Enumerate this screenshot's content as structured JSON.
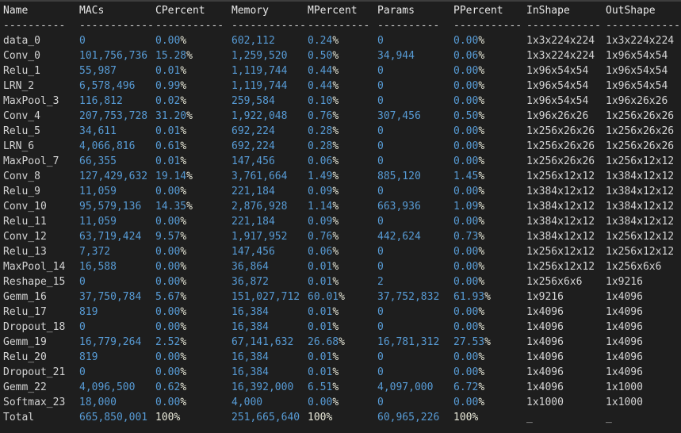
{
  "terminal": {
    "background": "#1e1e1e",
    "top_border": "#3d3d3d",
    "foreground": "#d4d4d4",
    "header_color": "#e8e8e8",
    "number_color": "#579bd5",
    "percent_sign_color": "#e9e9d9"
  },
  "table": {
    "columns": [
      "Name",
      "MACs",
      "CPercent",
      "Memory",
      "MPercent",
      "Params",
      "PPercent",
      "InShape",
      "OutShape"
    ],
    "separators": [
      "----------",
      "------------",
      "-----------",
      "------------",
      "----------",
      "----------",
      "-----------",
      "------------",
      "------------"
    ],
    "rows": [
      [
        "data_0",
        "0",
        "0.00%",
        "602,112",
        "0.24%",
        "0",
        "0.00%",
        "1x3x224x224",
        "1x3x224x224"
      ],
      [
        "Conv_0",
        "101,756,736",
        "15.28%",
        "1,259,520",
        "0.50%",
        "34,944",
        "0.06%",
        "1x3x224x224",
        "1x96x54x54"
      ],
      [
        "Relu_1",
        "55,987",
        "0.01%",
        "1,119,744",
        "0.44%",
        "0",
        "0.00%",
        "1x96x54x54",
        "1x96x54x54"
      ],
      [
        "LRN_2",
        "6,578,496",
        "0.99%",
        "1,119,744",
        "0.44%",
        "0",
        "0.00%",
        "1x96x54x54",
        "1x96x54x54"
      ],
      [
        "MaxPool_3",
        "116,812",
        "0.02%",
        "259,584",
        "0.10%",
        "0",
        "0.00%",
        "1x96x54x54",
        "1x96x26x26"
      ],
      [
        "Conv_4",
        "207,753,728",
        "31.20%",
        "1,922,048",
        "0.76%",
        "307,456",
        "0.50%",
        "1x96x26x26",
        "1x256x26x26"
      ],
      [
        "Relu_5",
        "34,611",
        "0.01%",
        "692,224",
        "0.28%",
        "0",
        "0.00%",
        "1x256x26x26",
        "1x256x26x26"
      ],
      [
        "LRN_6",
        "4,066,816",
        "0.61%",
        "692,224",
        "0.28%",
        "0",
        "0.00%",
        "1x256x26x26",
        "1x256x26x26"
      ],
      [
        "MaxPool_7",
        "66,355",
        "0.01%",
        "147,456",
        "0.06%",
        "0",
        "0.00%",
        "1x256x26x26",
        "1x256x12x12"
      ],
      [
        "Conv_8",
        "127,429,632",
        "19.14%",
        "3,761,664",
        "1.49%",
        "885,120",
        "1.45%",
        "1x256x12x12",
        "1x384x12x12"
      ],
      [
        "Relu_9",
        "11,059",
        "0.00%",
        "221,184",
        "0.09%",
        "0",
        "0.00%",
        "1x384x12x12",
        "1x384x12x12"
      ],
      [
        "Conv_10",
        "95,579,136",
        "14.35%",
        "2,876,928",
        "1.14%",
        "663,936",
        "1.09%",
        "1x384x12x12",
        "1x384x12x12"
      ],
      [
        "Relu_11",
        "11,059",
        "0.00%",
        "221,184",
        "0.09%",
        "0",
        "0.00%",
        "1x384x12x12",
        "1x384x12x12"
      ],
      [
        "Conv_12",
        "63,719,424",
        "9.57%",
        "1,917,952",
        "0.76%",
        "442,624",
        "0.73%",
        "1x384x12x12",
        "1x256x12x12"
      ],
      [
        "Relu_13",
        "7,372",
        "0.00%",
        "147,456",
        "0.06%",
        "0",
        "0.00%",
        "1x256x12x12",
        "1x256x12x12"
      ],
      [
        "MaxPool_14",
        "16,588",
        "0.00%",
        "36,864",
        "0.01%",
        "0",
        "0.00%",
        "1x256x12x12",
        "1x256x6x6"
      ],
      [
        "Reshape_15",
        "0",
        "0.00%",
        "36,872",
        "0.01%",
        "2",
        "0.00%",
        "1x256x6x6",
        "1x9216"
      ],
      [
        "Gemm_16",
        "37,750,784",
        "5.67%",
        "151,027,712",
        "60.01%",
        "37,752,832",
        "61.93%",
        "1x9216",
        "1x4096"
      ],
      [
        "Relu_17",
        "819",
        "0.00%",
        "16,384",
        "0.01%",
        "0",
        "0.00%",
        "1x4096",
        "1x4096"
      ],
      [
        "Dropout_18",
        "0",
        "0.00%",
        "16,384",
        "0.01%",
        "0",
        "0.00%",
        "1x4096",
        "1x4096"
      ],
      [
        "Gemm_19",
        "16,779,264",
        "2.52%",
        "67,141,632",
        "26.68%",
        "16,781,312",
        "27.53%",
        "1x4096",
        "1x4096"
      ],
      [
        "Relu_20",
        "819",
        "0.00%",
        "16,384",
        "0.01%",
        "0",
        "0.00%",
        "1x4096",
        "1x4096"
      ],
      [
        "Dropout_21",
        "0",
        "0.00%",
        "16,384",
        "0.01%",
        "0",
        "0.00%",
        "1x4096",
        "1x4096"
      ],
      [
        "Gemm_22",
        "4,096,500",
        "0.62%",
        "16,392,000",
        "6.51%",
        "4,097,000",
        "6.72%",
        "1x4096",
        "1x1000"
      ],
      [
        "Softmax_23",
        "18,000",
        "0.00%",
        "4,000",
        "0.00%",
        "0",
        "0.00%",
        "1x1000",
        "1x1000"
      ],
      [
        "Total",
        "665,850,001",
        "100%",
        "251,665,640",
        "100%",
        "60,965,226",
        "100%",
        "_",
        "_"
      ]
    ]
  }
}
